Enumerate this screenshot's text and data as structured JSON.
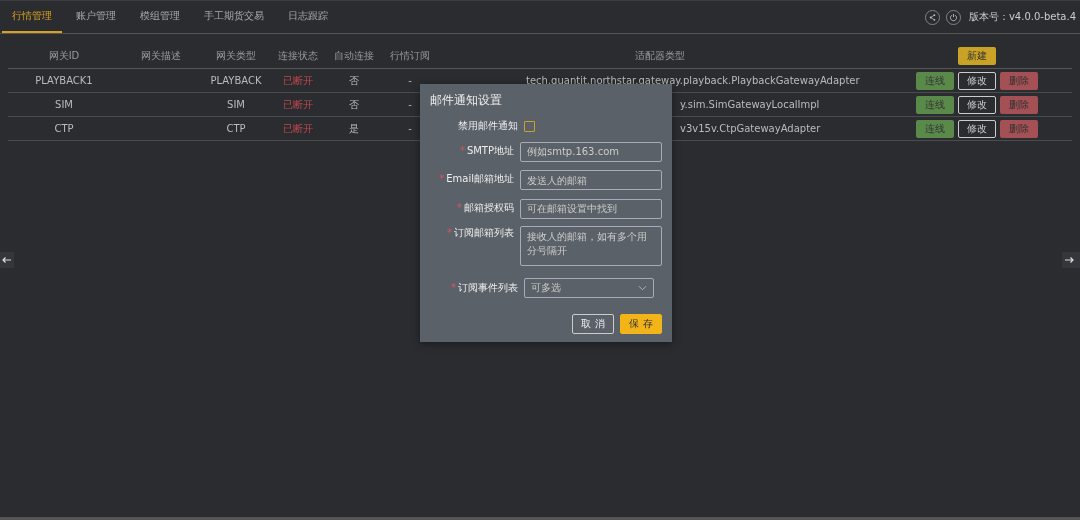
{
  "tabs": [
    {
      "label": "行情管理",
      "selected": true
    },
    {
      "label": "账户管理",
      "selected": false
    },
    {
      "label": "模组管理",
      "selected": false
    },
    {
      "label": "手工期货交易",
      "selected": false
    },
    {
      "label": "日志跟踪",
      "selected": false
    }
  ],
  "version": "版本号：v4.0.0-beta.4",
  "table": {
    "columns": [
      "网关ID",
      "网关描述",
      "网关类型",
      "连接状态",
      "自动连接",
      "行情订阅",
      "适配器类型"
    ],
    "new_button": "新建",
    "rows": [
      {
        "id": "PLAYBACK1",
        "desc": "",
        "type": "PLAYBACK",
        "status": "已断开",
        "auto": "否",
        "sub": "-",
        "adapter": "tech.quantit.northstar.gateway.playback.PlaybackGatewayAdapter",
        "adapter_cut": false,
        "actions": [
          "连线",
          "修改",
          "删除"
        ]
      },
      {
        "id": "SIM",
        "desc": "",
        "type": "SIM",
        "status": "已断开",
        "auto": "否",
        "sub": "-",
        "adapter": "y.sim.SimGatewayLocalImpl",
        "adapter_cut": true,
        "actions": [
          "连线",
          "修改",
          "删除"
        ]
      },
      {
        "id": "CTP",
        "desc": "",
        "type": "CTP",
        "status": "已断开",
        "auto": "是",
        "sub": "-",
        "adapter": "v3v15v.CtpGatewayAdapter",
        "adapter_cut": true,
        "actions": [
          "连线",
          "修改",
          "删除"
        ]
      }
    ]
  },
  "dialog": {
    "title": "邮件通知设置",
    "fields": [
      {
        "kind": "checkbox",
        "label": "禁用邮件通知",
        "required": false,
        "checked": false
      },
      {
        "kind": "input",
        "label": "SMTP地址",
        "required": true,
        "placeholder": "例如smtp.163.com"
      },
      {
        "kind": "input",
        "label": "Email邮箱地址",
        "required": true,
        "placeholder": "发送人的邮箱"
      },
      {
        "kind": "input",
        "label": "邮箱授权码",
        "required": true,
        "placeholder": "可在邮箱设置中找到"
      },
      {
        "kind": "textarea",
        "label": "订阅邮箱列表",
        "required": true,
        "placeholder": "接收人的邮箱，如有多个用分号隔开"
      },
      {
        "kind": "select",
        "label": "订阅事件列表",
        "required": true,
        "placeholder": "可多选"
      }
    ],
    "required_mark": "*",
    "buttons": [
      {
        "label": "取 消",
        "kind": "default"
      },
      {
        "label": "保 存",
        "kind": "primary"
      }
    ]
  }
}
